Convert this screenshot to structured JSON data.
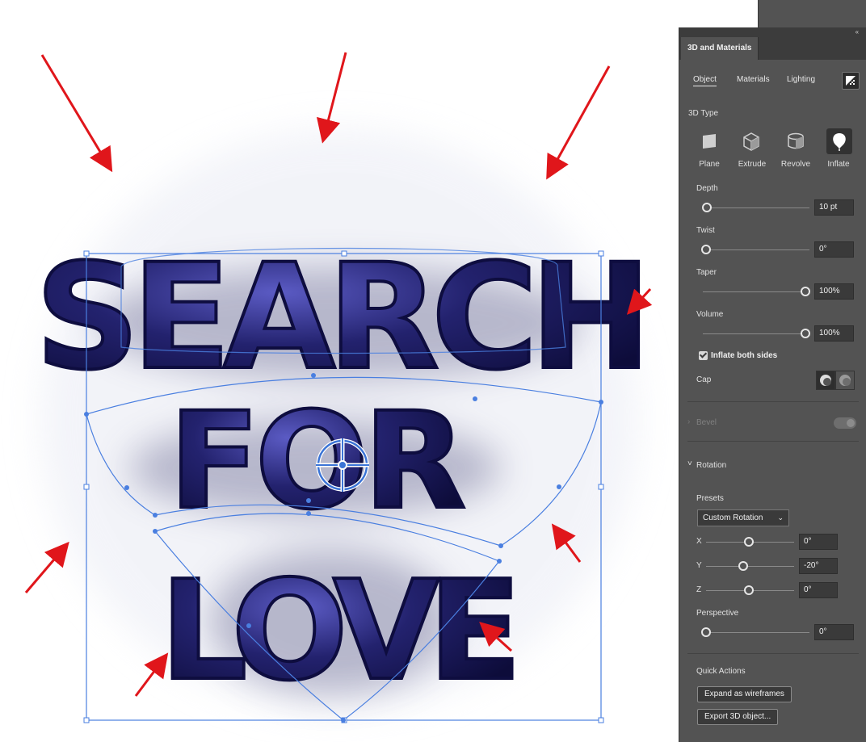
{
  "canvas": {
    "text_line_1": "SEARCH",
    "text_line_2": "FOR",
    "text_line_3": "LOVE",
    "letter_color": "#23226e",
    "selection_color": "#4a7fe0",
    "arrow_color": "#e0161b"
  },
  "panel": {
    "title": "3D and Materials",
    "collapse_icon": "‹‹",
    "tabs": [
      "Object",
      "Materials",
      "Lighting"
    ],
    "active_tab": "Object",
    "type_section_label": "3D Type",
    "types": [
      "Plane",
      "Extrude",
      "Revolve",
      "Inflate"
    ],
    "active_type": "Inflate",
    "depth": {
      "label": "Depth",
      "value": "10 pt"
    },
    "twist": {
      "label": "Twist",
      "value": "0°"
    },
    "taper": {
      "label": "Taper",
      "value": "100%"
    },
    "volume": {
      "label": "Volume",
      "value": "100%"
    },
    "inflate_both_sides": {
      "label": "Inflate both sides",
      "checked": true
    },
    "cap_label": "Cap",
    "bevel_label": "Bevel",
    "bevel_chevron": "›",
    "rotation_label": "Rotation",
    "rotation_chevron": "˅",
    "presets_label": "Presets",
    "preset_value": "Custom Rotation",
    "preset_chevron": "⌄",
    "x": {
      "label": "X",
      "value": "0°"
    },
    "y": {
      "label": "Y",
      "value": "-20°"
    },
    "z": {
      "label": "Z",
      "value": "0°"
    },
    "perspective": {
      "label": "Perspective",
      "value": "0°"
    },
    "quick_actions_label": "Quick Actions",
    "expand_button": "Expand as wireframes",
    "export_button": "Export 3D object..."
  }
}
